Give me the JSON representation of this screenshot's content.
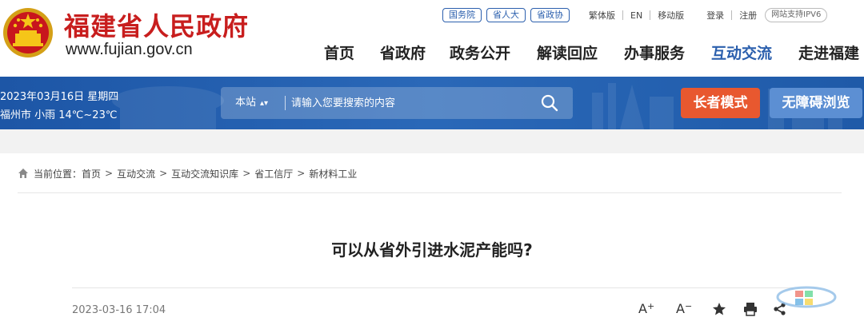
{
  "header": {
    "site_name": "福建省人民政府",
    "site_url": "www.fujian.gov.cn",
    "tag_links": [
      "国务院",
      "省人大",
      "省政协"
    ],
    "utility_links": [
      "繁体版",
      "EN",
      "移动版"
    ],
    "account_links": [
      "登录",
      "注册"
    ],
    "ipv6_badge": "网站支持IPV6",
    "nav": [
      "首页",
      "省政府",
      "政务公开",
      "解读回应",
      "办事服务",
      "互动交流",
      "走进福建"
    ],
    "active_nav": "互动交流"
  },
  "band": {
    "date": "2023年03月16日 星期四",
    "weather": "福州市 小雨 14℃~23℃",
    "search_scope": "本站",
    "search_placeholder": "请输入您要搜索的内容",
    "elder_mode_label": "长者模式",
    "accessibility_label": "无障碍浏览"
  },
  "breadcrumb": {
    "prefix": "当前位置：",
    "items": [
      "首页",
      "互动交流",
      "互动交流知识库",
      "省工信厅",
      "新材料工业"
    ]
  },
  "article": {
    "title": "可以从省外引进水泥产能吗?",
    "date": "2023-03-16 17:04"
  },
  "tools": {
    "font_larger": "A",
    "font_larger_sup": "+",
    "font_smaller": "A",
    "font_smaller_sup": "−"
  },
  "colors": {
    "brand_red": "#c81e1e",
    "nav_active": "#2b5fad",
    "band_blue": "#1d56a6",
    "elder_button": "#e8582f",
    "access_button": "#5c8fd3"
  },
  "icons": [
    "national-emblem-icon",
    "search-icon",
    "home-icon",
    "star-icon",
    "print-icon",
    "share-icon"
  ]
}
